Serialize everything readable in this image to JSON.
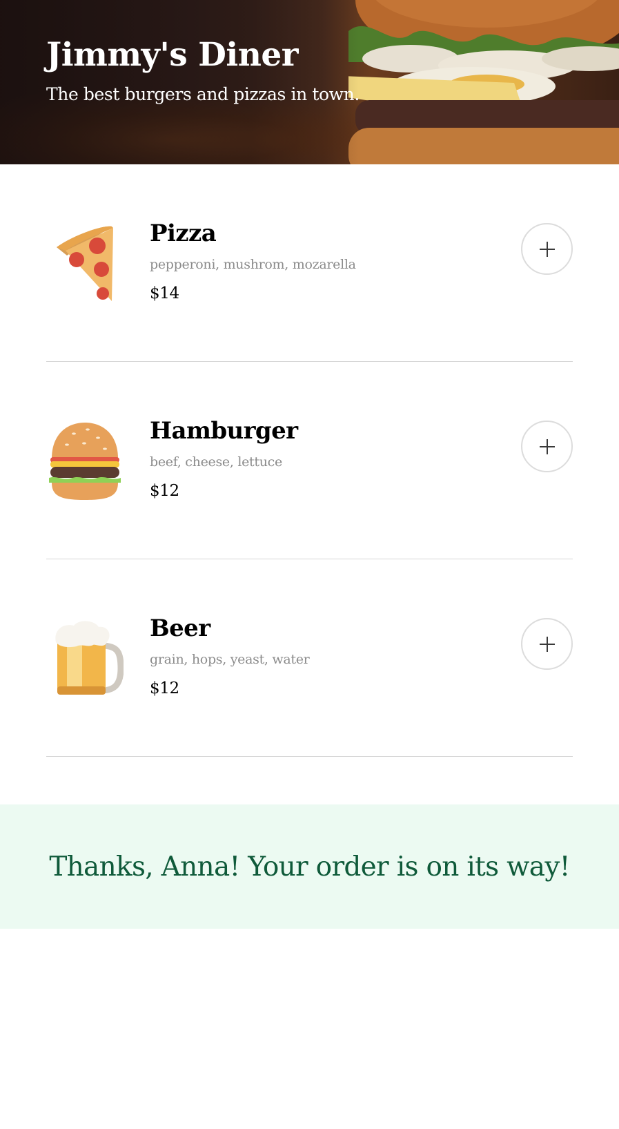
{
  "header": {
    "title": "Jimmy's Diner",
    "subtitle": "The best burgers and pizzas in town.",
    "image": "burger-photo"
  },
  "menu": {
    "items": [
      {
        "icon": "pizza-icon",
        "name": "Pizza",
        "ingredients": "pepperoni, mushrom, mozarella",
        "price": "$14",
        "add_button": "+"
      },
      {
        "icon": "hamburger-icon",
        "name": "Hamburger",
        "ingredients": "beef, cheese, lettuce",
        "price": "$12",
        "add_button": "+"
      },
      {
        "icon": "beer-icon",
        "name": "Beer",
        "ingredients": "grain, hops, yeast, water",
        "price": "$12",
        "add_button": "+"
      }
    ]
  },
  "order_confirmation": {
    "message": "Thanks, Anna! Your order is on its way!",
    "background": "#ecfaf2",
    "text_color": "#0f5a3a"
  }
}
